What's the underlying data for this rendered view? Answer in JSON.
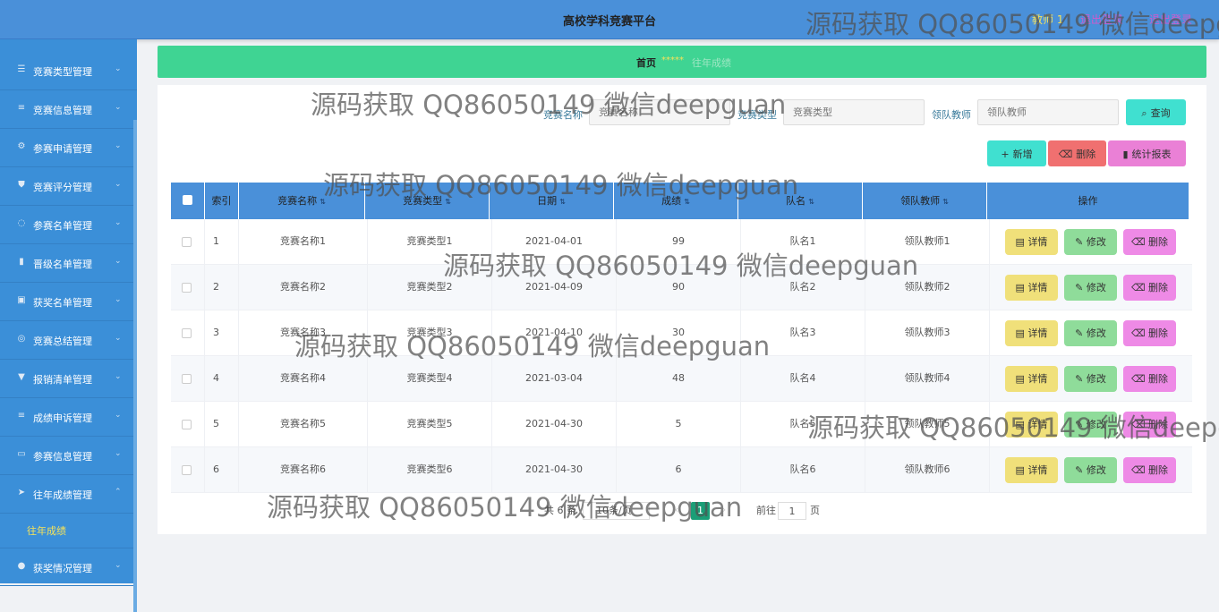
{
  "header": {
    "title": "高校学科竞赛平台",
    "user": "教师 1",
    "logout": "退出登录",
    "home_link": "退出登录"
  },
  "sidebar": {
    "items": [
      {
        "label": "竞赛类型管理",
        "icon": "sliders-icon"
      },
      {
        "label": "竞赛信息管理",
        "icon": "list-icon"
      },
      {
        "label": "参赛申请管理",
        "icon": "gear-icon"
      },
      {
        "label": "竞赛评分管理",
        "icon": "shield-icon"
      },
      {
        "label": "参赛名单管理",
        "icon": "circle-icon"
      },
      {
        "label": "晋级名单管理",
        "icon": "bar-chart-icon"
      },
      {
        "label": "获奖名单管理",
        "icon": "clipboard-icon"
      },
      {
        "label": "竞赛总结管理",
        "icon": "compass-icon"
      },
      {
        "label": "报销清单管理",
        "icon": "thumb-icon"
      },
      {
        "label": "成绩申诉管理",
        "icon": "list-icon"
      },
      {
        "label": "参赛信息管理",
        "icon": "monitor-icon"
      },
      {
        "label": "往年成绩管理",
        "icon": "send-icon"
      }
    ],
    "sub_item": "往年成绩",
    "last_item": {
      "label": "获奖情况管理",
      "icon": "user-icon"
    }
  },
  "breadcrumb": {
    "home": "首页",
    "stars": "*****",
    "current": "往年成绩"
  },
  "search": {
    "name_label": "竞赛名称",
    "name_placeholder": "竞赛名称",
    "type_label": "竞赛类型",
    "type_placeholder": "竞赛类型",
    "teacher_label": "领队教师",
    "teacher_placeholder": "领队教师",
    "query_button": "查询"
  },
  "toolbar": {
    "add": "新增",
    "delete": "删除",
    "report": "统计报表"
  },
  "table": {
    "headers": [
      "索引",
      "竞赛名称",
      "竞赛类型",
      "日期",
      "成绩",
      "队名",
      "领队教师",
      "操作"
    ],
    "rows": [
      [
        "1",
        "竞赛名称1",
        "竞赛类型1",
        "2021-04-01",
        "99",
        "队名1",
        "领队教师1"
      ],
      [
        "2",
        "竞赛名称2",
        "竞赛类型2",
        "2021-04-09",
        "90",
        "队名2",
        "领队教师2"
      ],
      [
        "3",
        "竞赛名称3",
        "竞赛类型3",
        "2021-04-10",
        "30",
        "队名3",
        "领队教师3"
      ],
      [
        "4",
        "竞赛名称4",
        "竞赛类型4",
        "2021-03-04",
        "48",
        "队名4",
        "领队教师4"
      ],
      [
        "5",
        "竞赛名称5",
        "竞赛类型5",
        "2021-04-30",
        "5",
        "队名5",
        "领队教师5"
      ],
      [
        "6",
        "竞赛名称6",
        "竞赛类型6",
        "2021-04-30",
        "6",
        "队名6",
        "领队教师6"
      ]
    ],
    "row_actions": {
      "detail": "详情",
      "edit": "修改",
      "delete": "删除"
    }
  },
  "pagination": {
    "total": "共 6 条",
    "page_size": "10条/页",
    "current_page": "1",
    "goto_prefix": "前往",
    "goto_value": "1",
    "goto_suffix": "页"
  },
  "watermark": "源码获取 QQ86050149 微信deepguan",
  "colors": {
    "topbar": "#4a90d9",
    "sidebar": "#3b8fd8",
    "breadcrumb": "#3fd493",
    "detail": "#f0e07a",
    "edit": "#8fdc9a",
    "delete": "#ee8ae6",
    "add": "#40e0d0",
    "delete_toolbar": "#f07070",
    "report": "#ea80d6"
  }
}
